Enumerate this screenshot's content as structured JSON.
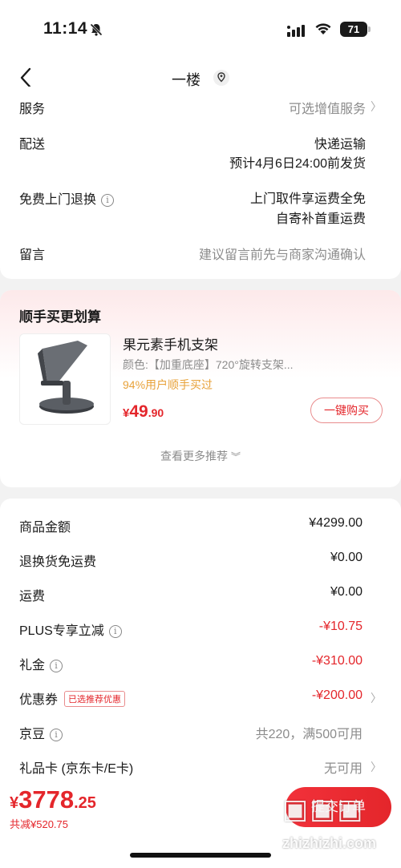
{
  "status": {
    "time": "11:14",
    "battery": "71"
  },
  "nav": {
    "title": "一楼"
  },
  "order": {
    "service_label": "服务",
    "service_value": "可选增值服务",
    "delivery_label": "配送",
    "delivery_value1": "快递运输",
    "delivery_value2": "预计4月6日24:00前发货",
    "return_label": "免费上门退换",
    "return_value1": "上门取件享运费全免",
    "return_value2": "自寄补首重运费",
    "message_label": "留言",
    "message_placeholder": "建议留言前先与商家沟通确认"
  },
  "recommend": {
    "title": "顺手买更划算",
    "product_name": "果元素手机支架",
    "product_spec": "颜色:【加重底座】720°旋转支架...",
    "bought_text": "94%用户顺手买过",
    "price_currency": "¥",
    "price_int": "49",
    "price_dec": ".90",
    "buy_button": "一键购买",
    "more_text": "查看更多推荐"
  },
  "summary": {
    "rows": [
      {
        "label": "商品金额",
        "value": "¥4299.00"
      },
      {
        "label": "退换货免运费",
        "value": "¥0.00"
      },
      {
        "label": "运费",
        "value": "¥0.00"
      },
      {
        "label": "PLUS专享立减",
        "value": "-¥10.75"
      },
      {
        "label": "礼金",
        "value": "-¥310.00"
      },
      {
        "label": "优惠券",
        "value": "-¥200.00",
        "tag": "已选推荐优惠"
      },
      {
        "label": "京豆",
        "value": "共220，满500可用"
      },
      {
        "label": "礼品卡 (京东卡/E卡)",
        "value": "无可用"
      }
    ]
  },
  "bottom": {
    "total_currency": "¥",
    "total_int": "3778",
    "total_dec": ".25",
    "saved": "共减¥520.75",
    "submit": "提交订单",
    "watermark": "zhizhizhi.com"
  },
  "colors": {
    "accent": "#e4262b",
    "orange": "#e8a23a",
    "gray": "#8c8c8c"
  }
}
